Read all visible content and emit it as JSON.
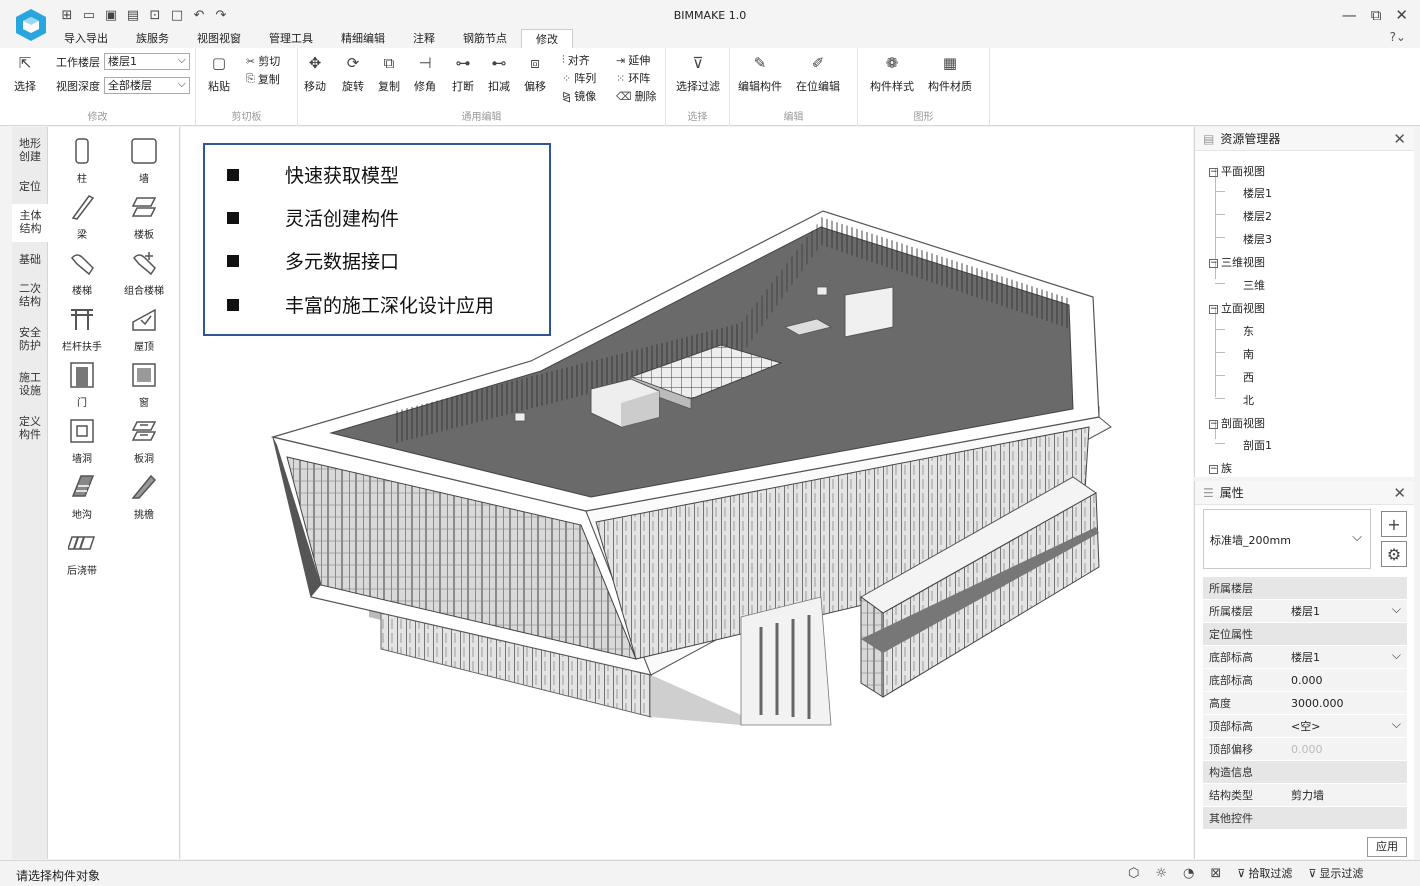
{
  "app": {
    "title": "BIMMAKE 1.0"
  },
  "quick_access": [
    "new-icon",
    "open-icon",
    "save-icon",
    "save-as-icon",
    "close-doc-icon",
    "window-icon",
    "undo-icon",
    "redo-icon"
  ],
  "menu": [
    "导入导出",
    "族服务",
    "视图视窗",
    "管理工具",
    "精细编辑",
    "注释",
    "钢筋节点",
    "修改"
  ],
  "ribbon": {
    "modify": {
      "label": "修改",
      "select": "选择",
      "work_floor_label": "工作楼层",
      "work_floor_value": "楼层1",
      "view_depth_label": "视图深度",
      "view_depth_value": "全部楼层"
    },
    "clipboard": {
      "label": "剪切板",
      "paste": "粘贴",
      "cut": "剪切",
      "copy": "复制"
    },
    "general_edit": {
      "label": "通用编辑",
      "move": "移动",
      "rotate": "旋转",
      "duplicate": "复制",
      "trim": "修角",
      "break": "打断",
      "deduct": "扣减",
      "offset": "偏移",
      "align": "对齐",
      "array": "阵列",
      "mirror": "镜像",
      "extend": "延伸",
      "ring_array": "环阵",
      "delete": "删除"
    },
    "select_group": {
      "label": "选择",
      "filter": "选择过滤"
    },
    "edit_group": {
      "label": "编辑",
      "edit_component": "编辑构件",
      "in_place_edit": "在位编辑"
    },
    "graphics_group": {
      "label": "图形",
      "component_style": "构件样式",
      "component_material": "构件材质"
    }
  },
  "categories": [
    "地形\n创建",
    "定位",
    "主体\n结构",
    "基础",
    "二次\n结构",
    "安全\n防护",
    "施工\n设施",
    "定义\n构件"
  ],
  "palette": [
    "柱",
    "墙",
    "梁",
    "楼板",
    "楼梯",
    "组合楼梯",
    "栏杆扶手",
    "屋顶",
    "门",
    "窗",
    "墙洞",
    "板洞",
    "地沟",
    "挑檐",
    "后浇带"
  ],
  "features": [
    "快速获取模型",
    "灵活创建构件",
    "多元数据接口",
    "丰富的施工深化设计应用"
  ],
  "resource_manager": {
    "title": "资源管理器",
    "plan": "平面视图",
    "floor1": "楼层1",
    "floor2": "楼层2",
    "floor3": "楼层3",
    "view3d": "三维视图",
    "view3d_item": "三维",
    "elevation": "立面视图",
    "east": "东",
    "south": "南",
    "west": "西",
    "north": "北",
    "section": "剖面视图",
    "section1": "剖面1",
    "family": "族"
  },
  "properties": {
    "title": "属性",
    "type": "标准墙_200mm",
    "rows": [
      {
        "kind": "sec",
        "k": "所属楼层"
      },
      {
        "kind": "item",
        "k": "所属楼层",
        "v": "楼层1",
        "dd": true
      },
      {
        "kind": "sec",
        "k": "定位属性"
      },
      {
        "kind": "item",
        "k": "底部标高",
        "v": "楼层1",
        "dd": true
      },
      {
        "kind": "item",
        "k": "底部标高",
        "v": "0.000"
      },
      {
        "kind": "item",
        "k": "高度",
        "v": "3000.000"
      },
      {
        "kind": "item",
        "k": "顶部标高",
        "v": "<空>",
        "dd": true
      },
      {
        "kind": "item",
        "k": "顶部偏移",
        "v": "0.000",
        "dim": true
      },
      {
        "kind": "sec",
        "k": "构造信息"
      },
      {
        "kind": "item",
        "k": "结构类型",
        "v": "剪力墙"
      },
      {
        "kind": "sec",
        "k": "其他控件"
      }
    ],
    "apply": "应用"
  },
  "status": {
    "text": "请选择构件对象",
    "pick_filter": "拾取过滤",
    "show_filter": "显示过滤"
  }
}
